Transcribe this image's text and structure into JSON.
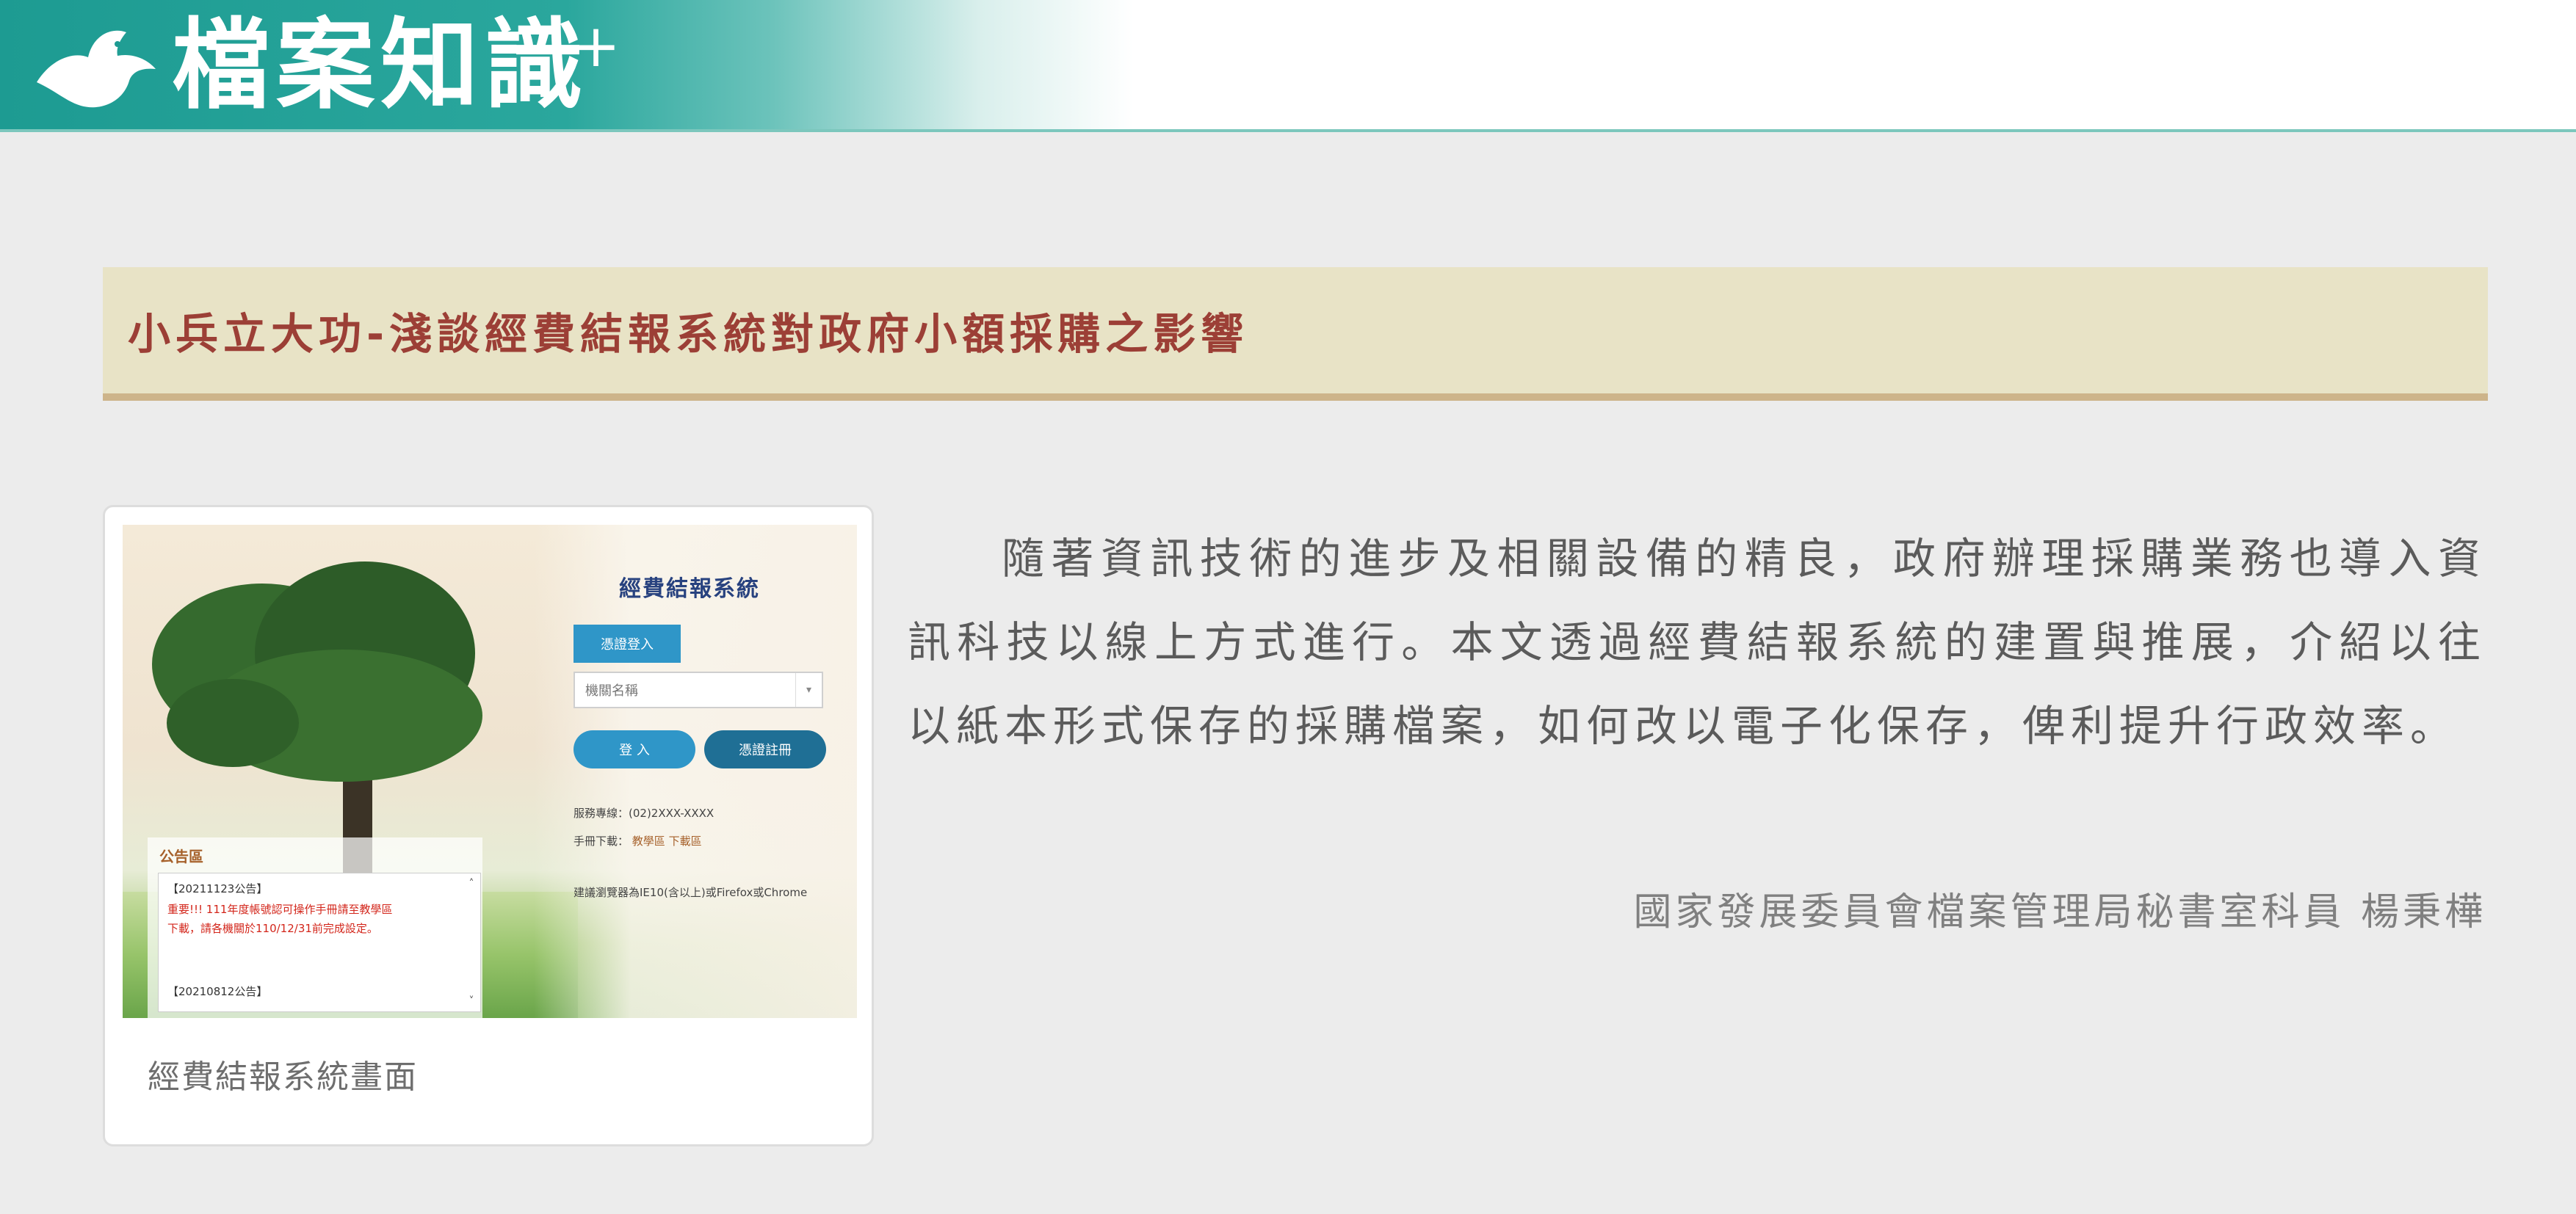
{
  "header": {
    "site_title": "檔案知識",
    "site_title_suffix": "+"
  },
  "article": {
    "title": "小兵立大功-淺談經費結報系統對政府小額採購之影響",
    "body": "隨著資訊技術的進步及相關設備的精良，政府辦理採購業務也導入資訊科技以線上方式進行。本文透過經費結報系統的建置與推展，介紹以往以紙本形式保存的採購檔案，如何改以電子化保存，俾利提升行政效率。",
    "author": "國家發展委員會檔案管理局秘書室科員 楊秉樺"
  },
  "figure": {
    "caption": "經費結報系統畫面",
    "screenshot": {
      "system_title": "經費結報系統",
      "login_tab": "憑證登入",
      "agency_select_placeholder": "機關名稱",
      "login_button": "登 入",
      "register_button": "憑證註冊",
      "contact_line": "服務專線：(02)2XXX-XXXX",
      "manual_label": "手冊下載：",
      "manual_links": "教學區 下載區",
      "browser_note": "建議瀏覽器為IE10(含以上)或Firefox或Chrome",
      "notice_title": "公告區",
      "notices": [
        "【20211123公告】",
        "重要!!! 111年度帳號認可操作手冊請至教學區",
        "下載，請各機關於110/12/31前完成設定。",
        "【20210812公告】"
      ]
    }
  },
  "colors": {
    "header_teal": "#1d9b92",
    "title_bar_bg": "#e8e3c6",
    "title_text": "#9c3f36",
    "title_bar_border": "#cdb48a",
    "page_bg": "#ececec"
  }
}
